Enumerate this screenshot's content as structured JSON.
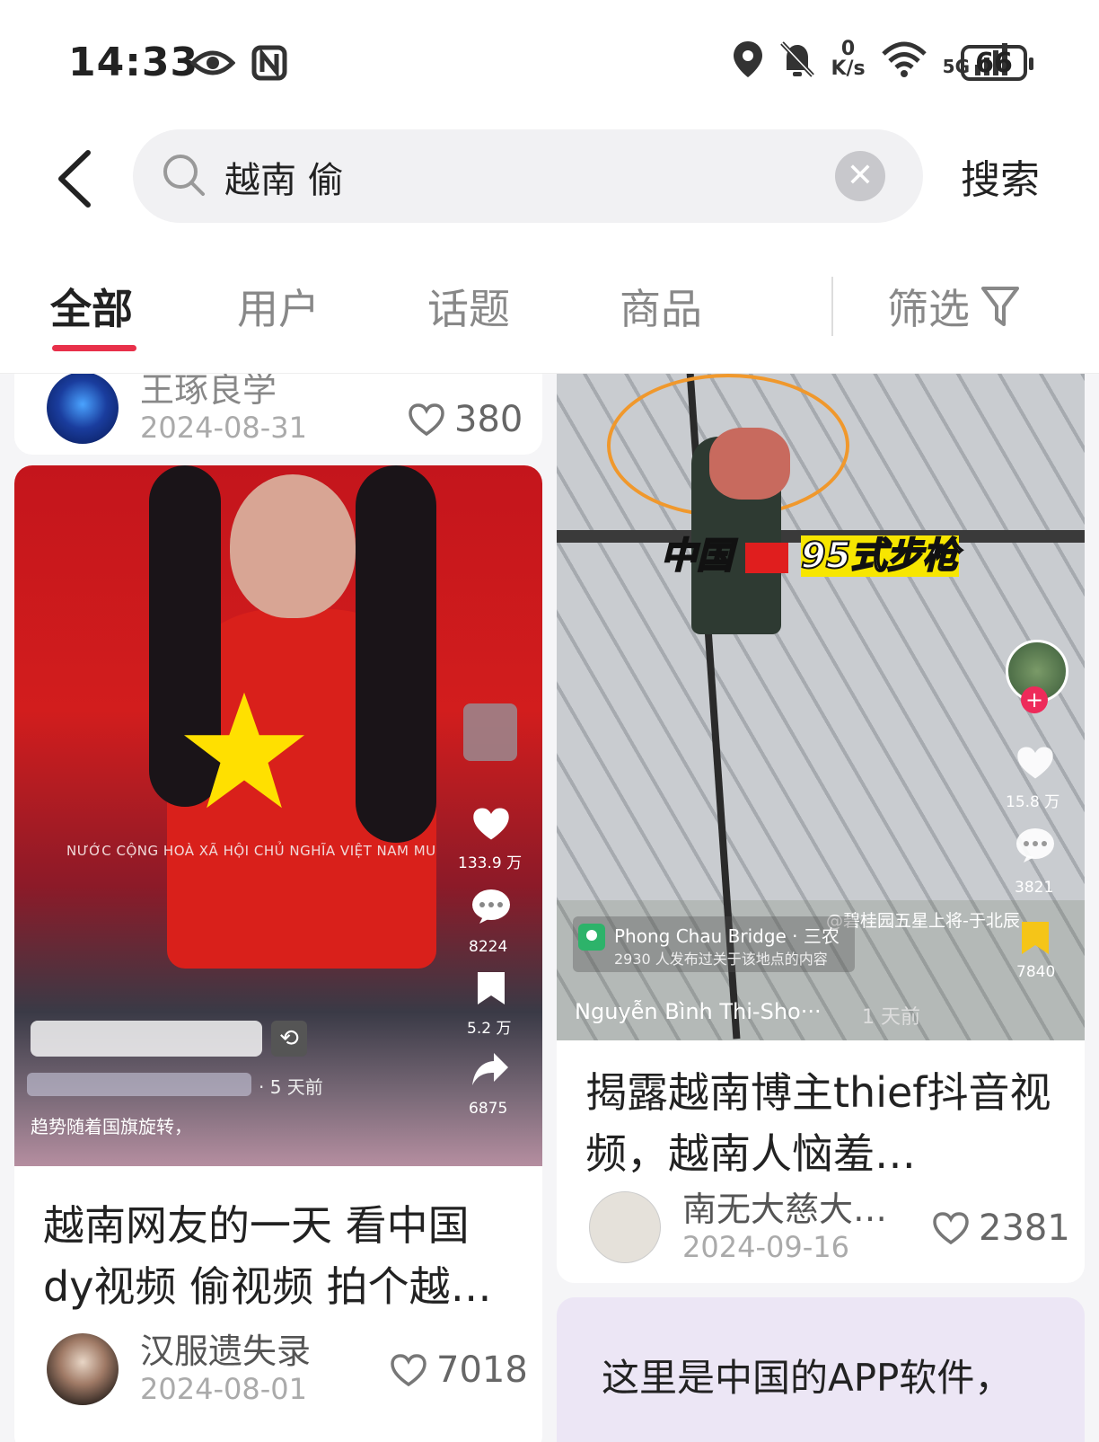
{
  "status_bar": {
    "time": "14:33",
    "net_speed_top": "0",
    "net_speed_unit": "K/s",
    "signal_label": "5G",
    "battery": "66"
  },
  "search": {
    "query": "越南 偷",
    "submit_label": "搜索"
  },
  "tabs": [
    {
      "label": "全部",
      "active": true
    },
    {
      "label": "用户",
      "active": false
    },
    {
      "label": "话题",
      "active": false
    },
    {
      "label": "商品",
      "active": false
    }
  ],
  "filter_label": "筛选",
  "cards": {
    "top_left": {
      "author": "王琢良学",
      "date": "2024-08-31",
      "likes": "380"
    },
    "left": {
      "title": "越南网友的一天 看中国dy视频 偷视频 拍个越…",
      "author": "汉服遗失录",
      "date": "2024-08-01",
      "likes": "7018",
      "overlay": {
        "banner_text": "NƯỚC CỘNG HOÀ XÃ HỘI CHỦ NGHĨA VIỆT NAM MU",
        "like_count": "133.9 万",
        "comment_count": "8224",
        "save_count": "5.2 万",
        "share_count": "6875",
        "time_ago": "· 5 天前",
        "caption": "趋势随着国旗旋转，"
      }
    },
    "right": {
      "title": "揭露越南博主thief抖音视频，越南人恼羞…",
      "author": "南无大慈大…",
      "date": "2024-09-16",
      "likes": "2381",
      "overlay": {
        "caption_red": "中国",
        "caption_yellow": "95式步枪",
        "like_count": "15.8 万",
        "comment_count": "3821",
        "save_count": "7840",
        "watermark": "@碧桂园五星上将-于北辰",
        "location": "Phong Chau Bridge · 三农",
        "location_sub": "2930 人发布过关于该地点的内容",
        "uploader": "Nguyễn Bình Thi-Sho···",
        "time_ago": "1 天前"
      }
    },
    "bottom_right": {
      "text": "这里是中国的APP软件，"
    }
  }
}
